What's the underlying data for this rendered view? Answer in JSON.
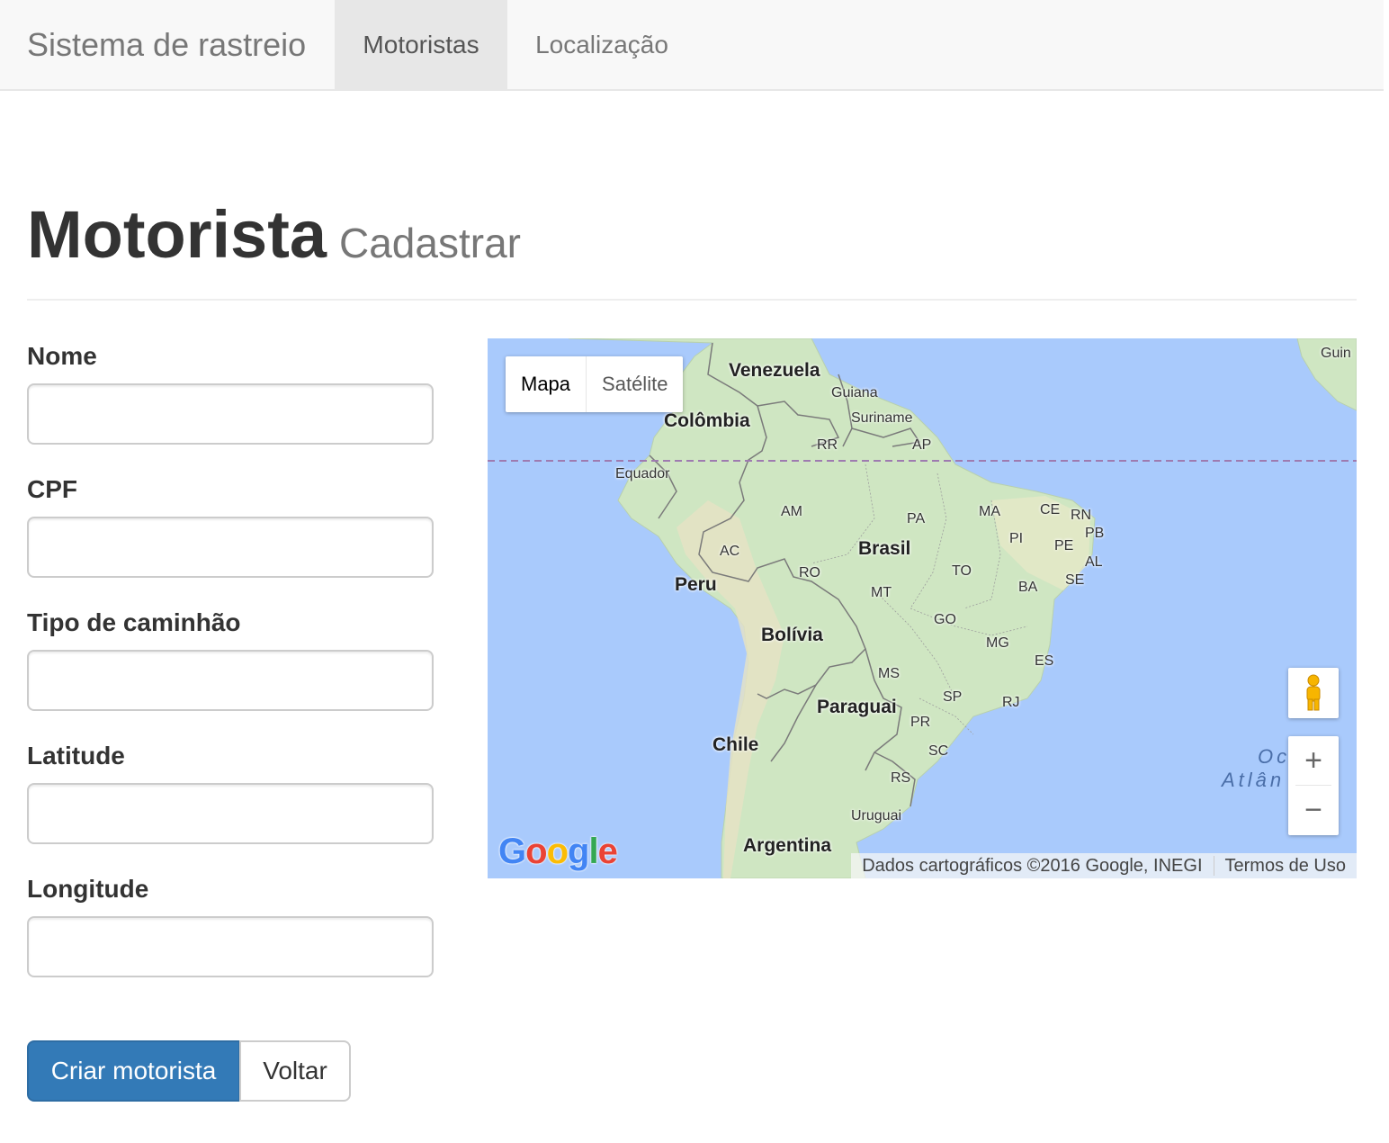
{
  "navbar": {
    "brand": "Sistema de rastreio",
    "items": [
      {
        "label": "Motoristas",
        "active": true
      },
      {
        "label": "Localização",
        "active": false
      }
    ]
  },
  "header": {
    "title": "Motorista",
    "subtitle": "Cadastrar"
  },
  "form": {
    "fields": [
      {
        "label": "Nome",
        "value": ""
      },
      {
        "label": "CPF",
        "value": ""
      },
      {
        "label": "Tipo de caminhão",
        "value": ""
      },
      {
        "label": "Latitude",
        "value": ""
      },
      {
        "label": "Longitude",
        "value": ""
      }
    ],
    "submit_label": "Criar motorista",
    "back_label": "Voltar",
    "primary_color": "#337ab7"
  },
  "map": {
    "type_control": {
      "map": "Mapa",
      "satellite": "Satélite",
      "selected": "Mapa"
    },
    "countries": [
      "Venezuela",
      "Guiana",
      "Suriname",
      "Colômbia",
      "Equador",
      "Peru",
      "Brasil",
      "Bolívia",
      "Paraguai",
      "Chile",
      "Uruguai",
      "Argentina",
      "Guin"
    ],
    "states": [
      "RR",
      "AP",
      "AM",
      "PA",
      "MA",
      "CE",
      "RN",
      "PB",
      "PI",
      "PE",
      "AL",
      "SE",
      "AC",
      "RO",
      "TO",
      "BA",
      "MT",
      "GO",
      "MG",
      "MS",
      "ES",
      "SP",
      "RJ",
      "PR",
      "SC",
      "RS"
    ],
    "ocean_label_1": "Oc   o",
    "ocean_label_2": "Atlân    S",
    "logo": "Google",
    "attribution": "Dados cartográficos ©2016 Google, INEGI",
    "terms": "Termos de Uso",
    "zoom_in": "+",
    "zoom_out": "−",
    "water_color": "#a9cafc",
    "land_color": "#cde6c4"
  }
}
